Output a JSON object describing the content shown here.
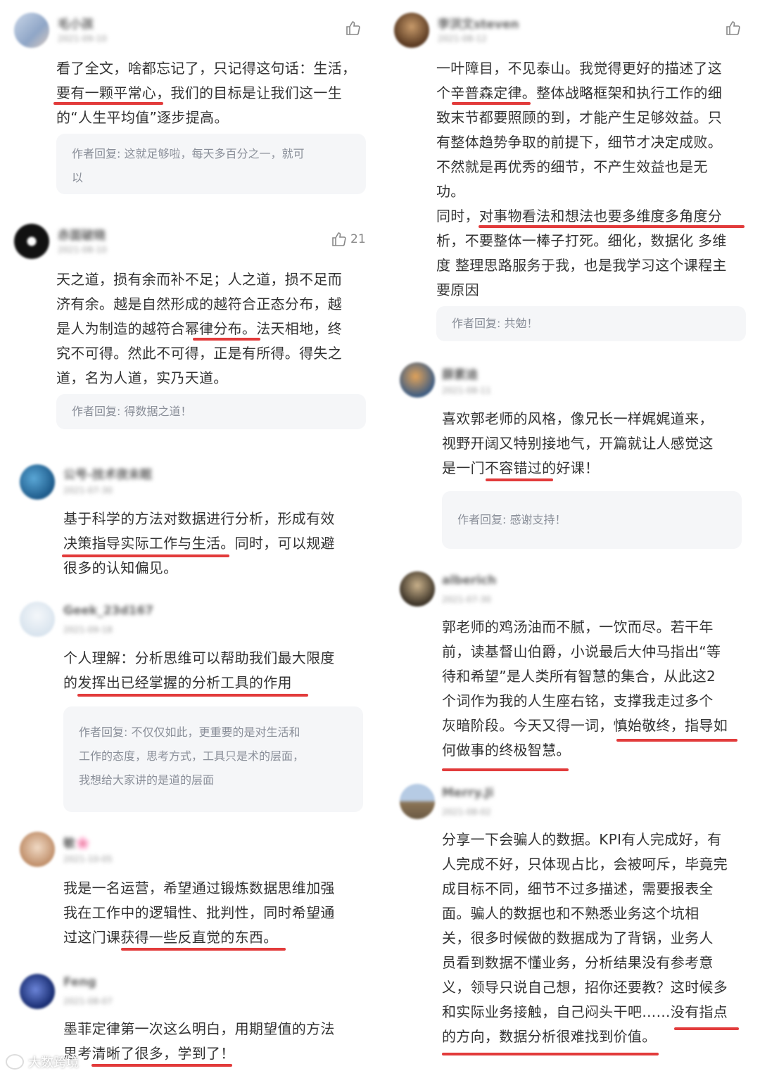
{
  "left": [
    {
      "user": "毛小孩",
      "date": "2021-09-10",
      "likes": "",
      "lines": [
        "看了全文，啥都忘记了，只记得这句话：生活，",
        "要有一颗平常心，我们的目标是让我们这一生",
        "的“人生平均值”逐步提高。"
      ],
      "reply": [
        "作者回复: 这就足够啦，每天多百分之一，就可",
        "以"
      ]
    },
    {
      "user": "赤面破晓",
      "date": "2021-08-10",
      "likes": "21",
      "lines": [
        "天之道，损有余而补不足；人之道，损不足而",
        "济有余。越是自然形成的越符合正态分布，越",
        "是人为制造的越符合幂律分布。法天相地，终",
        "究不可得。然此不可得，正是有所得。得失之",
        "道，名为人道，实乃天道。"
      ],
      "reply": [
        "作者回复: 得数据之道！"
      ]
    },
    {
      "user": "公号-技术夜未眠",
      "date": "2021-07-30",
      "likes": "",
      "lines": [
        "基于科学的方法对数据进行分析，形成有效",
        "决策指导实际工作与生活。同时，可以规避",
        "很多的认知偏见。"
      ],
      "reply": []
    },
    {
      "user": "Geek_23d167",
      "date": "2021-09-18",
      "likes": "",
      "lines": [
        "个人理解：分析思维可以帮助我们最大限度",
        "的发挥出已经掌握的分析工具的作用"
      ],
      "reply": [
        "作者回复: 不仅仅如此，更重要的是对生活和",
        "工作的态度，思考方式，工具只是术的层面，",
        "我想给大家讲的是道的层面"
      ]
    },
    {
      "user": "敏🌸",
      "date": "2021-10-05",
      "likes": "",
      "lines": [
        "我是一名运营，希望通过锻炼数据思维加强",
        "我在工作中的逻辑性、批判性，同时希望通",
        "过这门课获得一些反直觉的东西。"
      ],
      "reply": []
    },
    {
      "user": "Feng",
      "date": "2021-08-07",
      "likes": "",
      "lines": [
        "墨菲定律第一次这么明白，用期望值的方法",
        "思考清晰了很多，学到了！"
      ],
      "reply": []
    }
  ],
  "right": [
    {
      "user": "李洪文steven",
      "date": "2021-08-12",
      "likes": "",
      "lines": [
        "一叶障目，不见泰山。我觉得更好的描述了这",
        "个辛普森定律。整体战略框架和执行工作的细",
        "致末节都要照顾的到，才能产生足够效益。只",
        "有整体趋势争取的前提下，细节才决定成败。",
        "不然就是再优秀的细节，不产生效益也是无",
        "功。",
        "同时，对事物看法和想法也要多维度多角度分",
        "析，不要整体一棒子打死。细化，数据化 多维",
        "度 整理思路服务于我，也是我学习这个课程主",
        "要原因"
      ],
      "reply": [
        "作者回复: 共勉！"
      ]
    },
    {
      "user": "薛素迪",
      "date": "2021-08-11",
      "likes": "",
      "lines": [
        "喜欢郭老师的风格，像兄长一样娓娓道来，",
        "视野开阔又特别接地气，开篇就让人感觉这",
        "是一门不容错过的好课！"
      ],
      "reply": [
        "作者回复: 感谢支持！"
      ]
    },
    {
      "user": "alberich",
      "date": "2021-07-30",
      "likes": "",
      "lines": [
        "郭老师的鸡汤油而不腻，一饮而尽。若干年",
        "前，读基督山伯爵，小说最后大仲马指出“等",
        "待和希望”是人类所有智慧的集合，从此这2",
        "个词作为我的人生座右铭，支撑我走过多个",
        "灰暗阶段。今天又得一词，慎始敬终，指导如",
        "何做事的终极智慧。"
      ],
      "reply": []
    },
    {
      "user": "Merry.Ji",
      "date": "2021-08-02",
      "likes": "",
      "lines": [
        "分享一下会骗人的数据。KPI有人完成好，有",
        "人完成不好，只体现占比，会被呵斥，毕竟完",
        "成目标不同，细节不过多描述，需要报表全",
        "面。骗人的数据也和不熟悉业务这个坑相",
        "关，很多时候做的数据成为了背锅，业务人",
        "员看到数据不懂业务，分析结果没有参考意",
        "义，领导只说自己想，招你还要教？这时候多",
        "和实际业务接触，自己闷头干吧……没有指点",
        "的方向，数据分析很难找到价值。"
      ],
      "reply": []
    }
  ],
  "watermark": "大数跨境",
  "colors": {
    "underline": "#e23b3b",
    "reply_bg": "#f5f6f8"
  }
}
